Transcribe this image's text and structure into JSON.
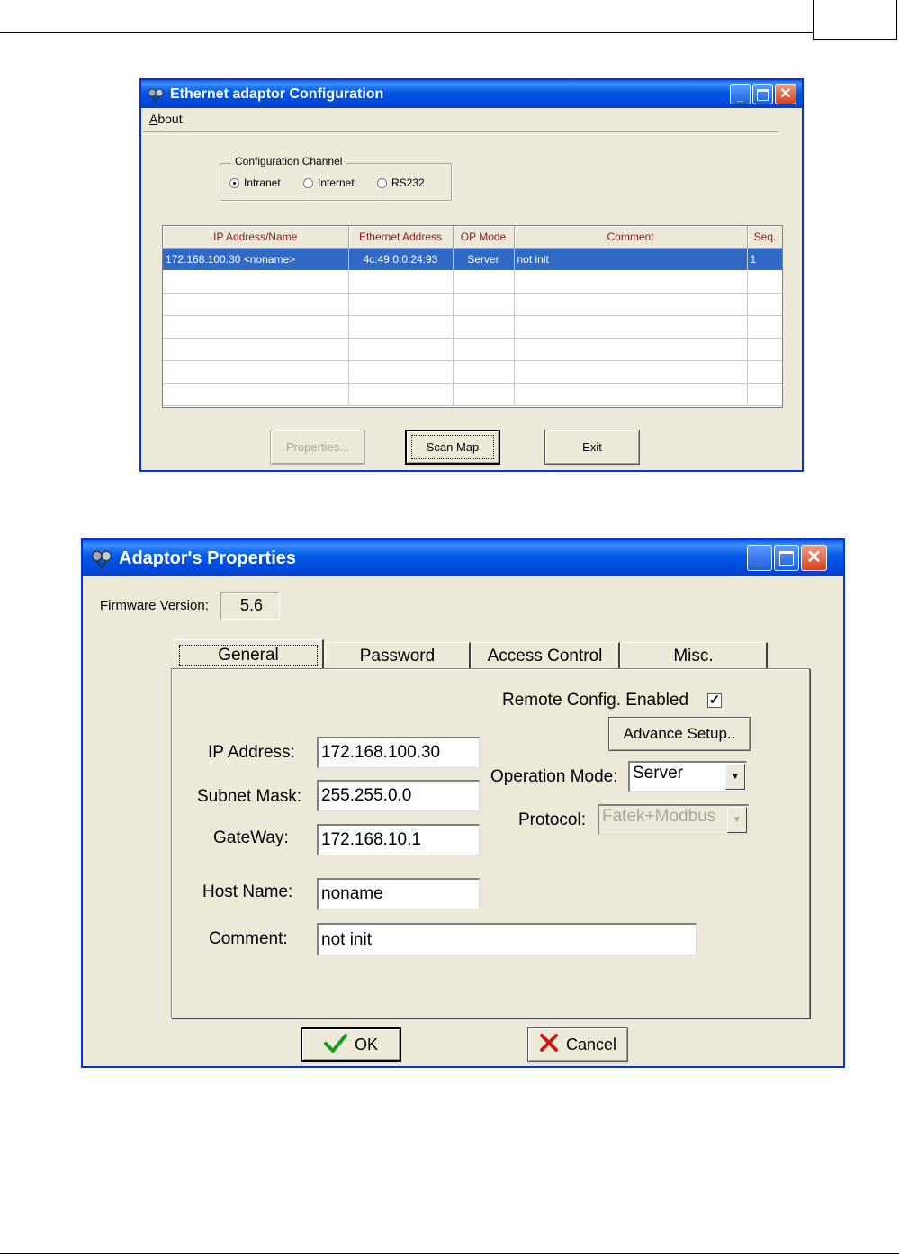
{
  "window1": {
    "title": "Ethernet adaptor Configuration",
    "menu": {
      "about_accel": "A",
      "about_rest": "bout"
    },
    "channel": {
      "title": "Configuration Channel",
      "options": [
        {
          "label": "Intranet",
          "selected": true
        },
        {
          "label": "Internet",
          "selected": false
        },
        {
          "label": "RS232",
          "selected": false
        }
      ]
    },
    "table": {
      "columns": [
        "IP Address/Name",
        "Ethernet Address",
        "OP Mode",
        "Comment",
        "Seq."
      ],
      "rows": [
        {
          "ip": "172.168.100.30 <noname>",
          "mac": "4c:49:0:0:24:93",
          "mode": "Server",
          "comment": "not init",
          "seq": "1"
        }
      ]
    },
    "buttons": {
      "properties": "Properties...",
      "scan_map": "Scan Map",
      "exit": "Exit"
    }
  },
  "window2": {
    "title": "Adaptor's Properties",
    "firmware_label": "Firmware Version:",
    "firmware_value": "5.6",
    "tabs": [
      "General",
      "Password",
      "Access Control",
      "Misc."
    ],
    "remote_config_label": "Remote Config. Enabled",
    "remote_config_checked": true,
    "advance_setup": "Advance Setup..",
    "fields": {
      "ip_label": "IP Address:",
      "ip_value": "172.168.100.30",
      "mask_label": "Subnet Mask:",
      "mask_value": "255.255.0.0",
      "gw_label": "GateWay:",
      "gw_value": "172.168.10.1",
      "host_label": "Host Name:",
      "host_value": "noname",
      "comment_label": "Comment:",
      "comment_value": "not init"
    },
    "operation_mode_label": "Operation Mode:",
    "operation_mode_value": "Server",
    "protocol_label": "Protocol:",
    "protocol_value": "Fatek+Modbus",
    "ok": "OK",
    "cancel": "Cancel"
  }
}
